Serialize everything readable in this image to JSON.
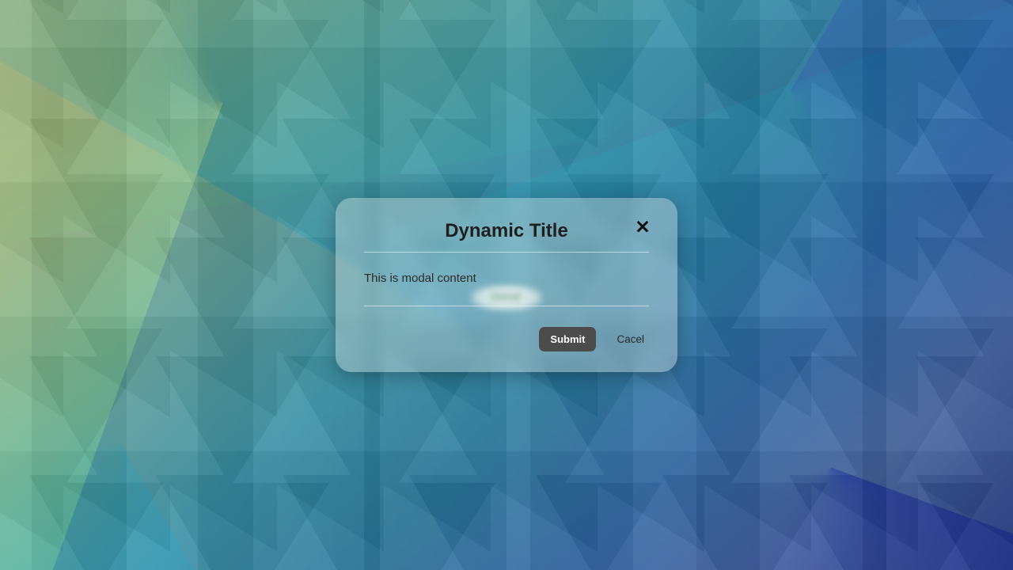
{
  "modal": {
    "title": "Dynamic Title",
    "content": "This is modal content",
    "hidden_popup_label": "POPUP",
    "buttons": {
      "submit": "Submit",
      "cancel": "Cacel"
    },
    "icons": {
      "close": "close-icon"
    }
  }
}
